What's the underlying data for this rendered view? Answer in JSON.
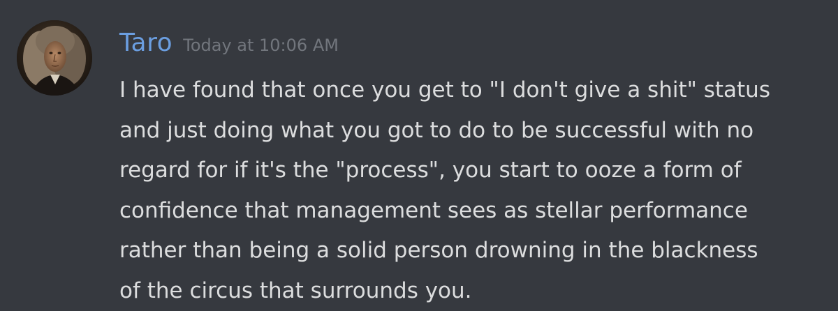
{
  "message": {
    "author": "Taro",
    "timestamp": "Today at 10:06 AM",
    "lines": [
      "I have found that once you get to \"I don't give a shit\" status",
      "and just doing what you got to do to be successful with no",
      "regard for if it's the \"process\", you start to ooze a form of",
      "confidence that management sees as stellar performance",
      "rather than being a solid person drowning in the blackness",
      "of the circus that surrounds you."
    ]
  },
  "colors": {
    "background": "#36393f",
    "author": "#6b9ee0",
    "timestamp": "#72767d",
    "text": "#dcddde"
  }
}
